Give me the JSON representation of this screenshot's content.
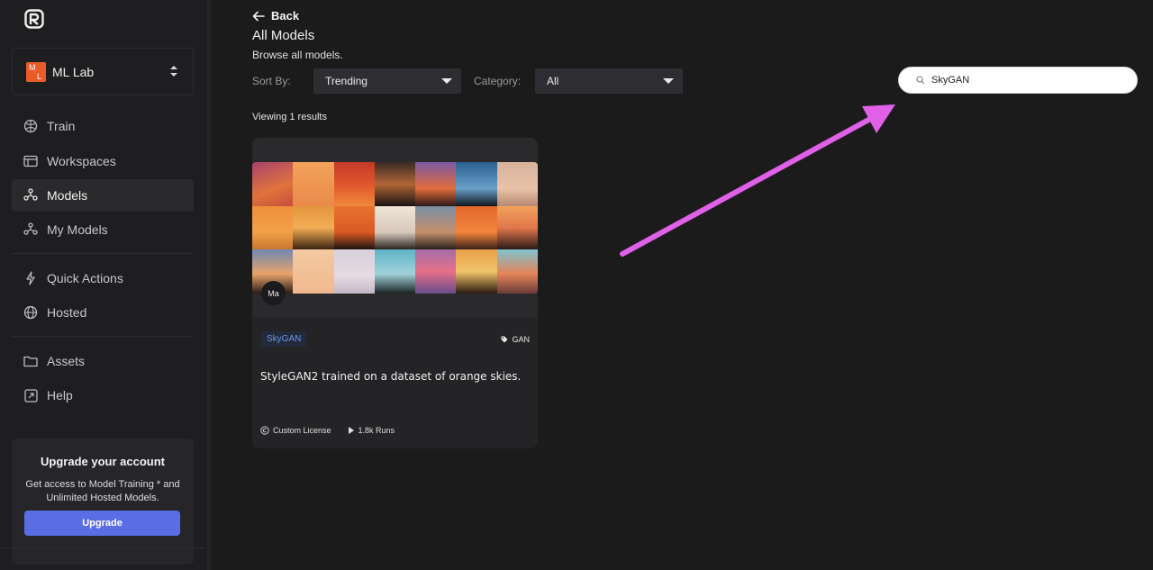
{
  "app": {
    "logo": "brand-logo"
  },
  "workspace": {
    "name": "ML Lab",
    "avatar_top": "M",
    "avatar_bottom": "L"
  },
  "sidebar": {
    "items": [
      {
        "label": "Train",
        "icon": "brain-icon"
      },
      {
        "label": "Workspaces",
        "icon": "workspace-icon"
      },
      {
        "label": "Models",
        "icon": "models-icon",
        "active": true
      },
      {
        "label": "My Models",
        "icon": "my-models-icon"
      },
      {
        "label": "Quick Actions",
        "icon": "lightning-icon"
      },
      {
        "label": "Hosted",
        "icon": "globe-icon"
      },
      {
        "label": "Assets",
        "icon": "folder-icon"
      },
      {
        "label": "Help",
        "icon": "external-link-icon"
      }
    ]
  },
  "upgrade": {
    "title": "Upgrade your account",
    "description": "Get access to Model Training * and Unlimited Hosted Models.",
    "button": "Upgrade"
  },
  "header": {
    "back": "Back",
    "title": "All Models",
    "subtitle": "Browse all models."
  },
  "filters": {
    "sort_label": "Sort By:",
    "sort_value": "Trending",
    "category_label": "Category:",
    "category_value": "All"
  },
  "search": {
    "value": "SkyGAN"
  },
  "results": {
    "text": "Viewing 1 results"
  },
  "card": {
    "author_initials": "Ma",
    "name": "SkyGAN",
    "type": "GAN",
    "description": "StyleGAN2 trained on a dataset of orange skies.",
    "license": "Custom License",
    "runs": "1.8k Runs"
  },
  "colors": {
    "background": "#1b1b1c",
    "sidebar": "#1e1e20",
    "accent": "#5b6de4",
    "workspace_avatar": "#e95c2a",
    "annotation_arrow": "#e060e8",
    "tag_text": "#6b93e6"
  }
}
